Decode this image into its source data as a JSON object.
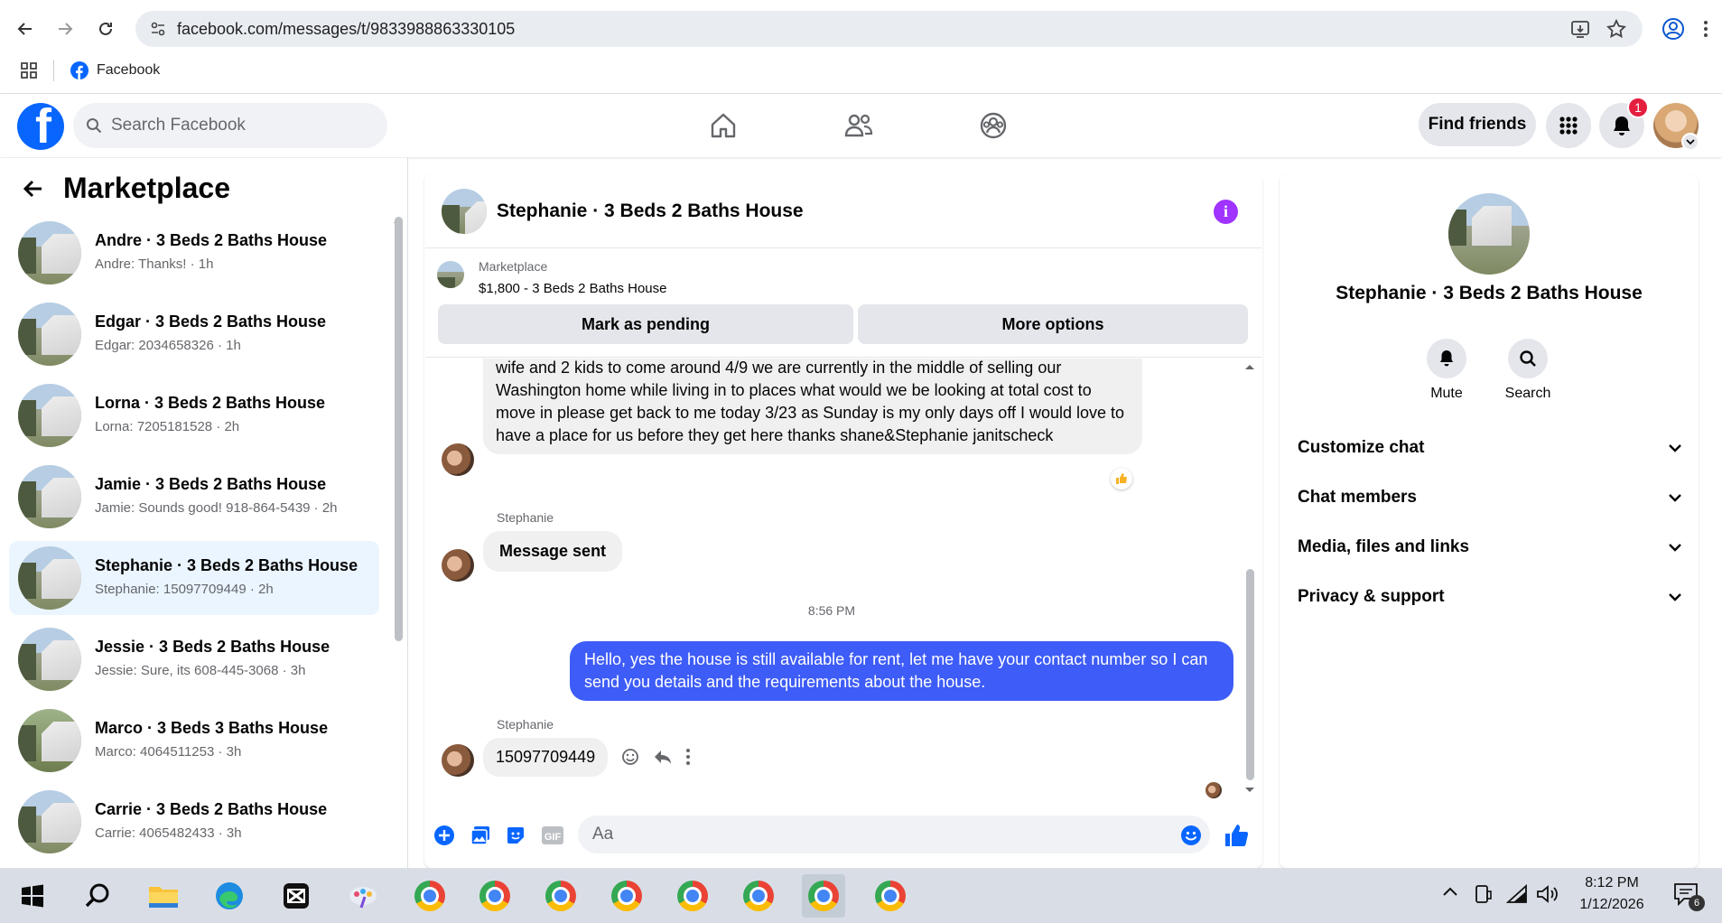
{
  "browser": {
    "url": "facebook.com/messages/t/9833988863330105",
    "bookmarks": [
      {
        "label": "Facebook"
      }
    ]
  },
  "fb_header": {
    "search_placeholder": "Search Facebook",
    "find_friends_label": "Find friends",
    "notification_count": "1"
  },
  "left_panel": {
    "title": "Marketplace",
    "conversations": [
      {
        "name": "Andre · 3 Beds 2 Baths House",
        "snippet": "Andre: Thanks! · 1h"
      },
      {
        "name": "Edgar · 3 Beds 2 Baths House",
        "snippet": "Edgar: 2034658326 · 1h"
      },
      {
        "name": "Lorna · 3 Beds 2 Baths House",
        "snippet": "Lorna: 7205181528 · 2h"
      },
      {
        "name": "Jamie · 3 Beds 2 Baths House",
        "snippet": "Jamie: Sounds good! 918-864-5439 · 2h"
      },
      {
        "name": "Stephanie · 3 Beds 2 Baths House",
        "snippet": "Stephanie: 15097709449 · 2h"
      },
      {
        "name": "Jessie · 3 Beds 2 Baths House",
        "snippet": "Jessie: Sure, its 608-445-3068 · 3h"
      },
      {
        "name": "Marco · 3 Beds 3 Baths House",
        "snippet": "Marco: 4064511253 · 3h"
      },
      {
        "name": "Carrie · 3 Beds 2 Baths House",
        "snippet": "Carrie: 4065482433 · 3h"
      }
    ]
  },
  "chat": {
    "title": "Stephanie · 3 Beds 2 Baths House",
    "marketplace_label": "Marketplace",
    "listing": "$1,800 - 3 Beds 2 Baths House",
    "mark_pending_label": "Mark as pending",
    "more_options_label": "More options",
    "messages": [
      {
        "from": "in",
        "text": "wife and 2 kids to come around 4/9 we are currently in the middle of selling our Washington home while living in to places what would we be looking at total cost to move in please get back to me today 3/23 as Sunday is my only days off I would love to have a place for us before they get here thanks  shane&Stephanie janitscheck"
      },
      {
        "from": "in",
        "sender": "Stephanie",
        "text": "Message sent"
      },
      {
        "timestamp": "8:56 PM"
      },
      {
        "from": "out",
        "text": "Hello, yes the house is still available for rent, let me have your contact number so I can send you details and the requirements about the house."
      },
      {
        "from": "in",
        "sender": "Stephanie",
        "text": "15097709449"
      }
    ],
    "composer_placeholder": "Aa"
  },
  "right_panel": {
    "name": "Stephanie · 3 Beds 2 Baths House",
    "actions": [
      {
        "label": "Mute"
      },
      {
        "label": "Search"
      }
    ],
    "sections": [
      {
        "label": "Customize chat"
      },
      {
        "label": "Chat members"
      },
      {
        "label": "Media, files and links"
      },
      {
        "label": "Privacy & support"
      }
    ]
  },
  "taskbar": {
    "time": "8:12 PM",
    "date": "1/12/2026",
    "notification_count": "6"
  },
  "colors": {
    "fb_blue": "#0866ff",
    "outgoing_bubble": "#3e5cf7",
    "info_purple": "#a033ff",
    "active_conversation": "#ebf5ff"
  }
}
